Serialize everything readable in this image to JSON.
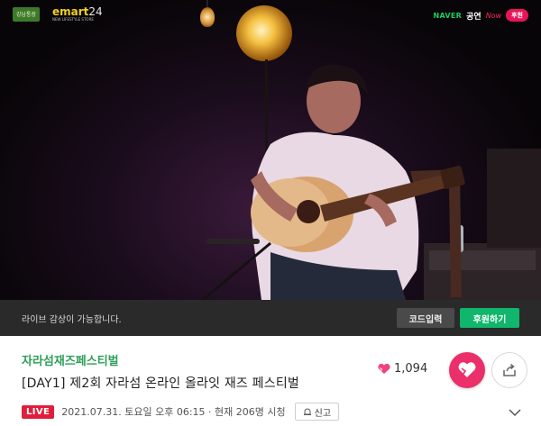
{
  "video": {
    "logos": {
      "badge": "강남통장",
      "emart": "emart",
      "emart_num": "24",
      "emart_sub": "NEW LIFESTYLE STORE"
    },
    "sponsor": {
      "naver": "NAVER",
      "gongyeon": "공연",
      "now": "Now",
      "support": "후원"
    }
  },
  "player_bar": {
    "message": "라이브 감상이 가능합니다.",
    "code_button": "코드입력",
    "support_button": "후원하기"
  },
  "info": {
    "channel": "자라섬재즈페스티벌",
    "title": "[DAY1] 제2회 자라섬 온라인 올라잇 재즈 페스티벌",
    "likes": "1,094",
    "live_badge": "LIVE",
    "meta": "2021.07.31. 토요일 오후 06:15 · 현재 206명 시청",
    "report": "신고"
  },
  "colors": {
    "accent_green": "#0fb66b",
    "channel_green": "#2e9e58",
    "like_pink": "#ea2f6a",
    "live_red": "#e01e3c"
  },
  "icons": [
    "heart-icon",
    "like-heart-icon",
    "share-icon",
    "report-icon",
    "chevron-down-icon"
  ]
}
